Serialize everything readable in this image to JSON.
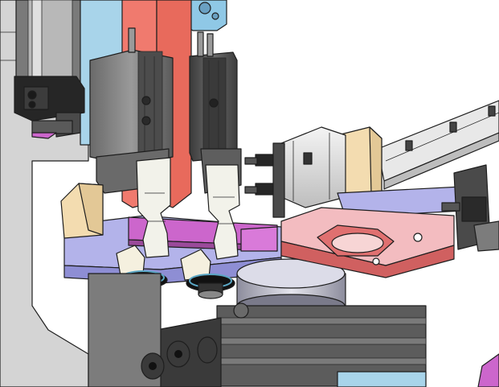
{
  "scene": {
    "kind": "cad-assembly-view",
    "colors": {
      "background": "#ffffff",
      "lavender": "#b3b3ea",
      "magenta": "#cc66cc",
      "salmon": "#f07a6e",
      "cream": "#f3dcb0",
      "red_plate": "#e07070",
      "pink_plate": "#f3bcc0",
      "sky_blue": "#a8d4ea",
      "dark_gray": "#5c5c5c",
      "mid_gray": "#8a8a8a",
      "light_gray": "#cfcfcf",
      "black": "#222222",
      "teal_ring": "#5aa6c4"
    }
  }
}
